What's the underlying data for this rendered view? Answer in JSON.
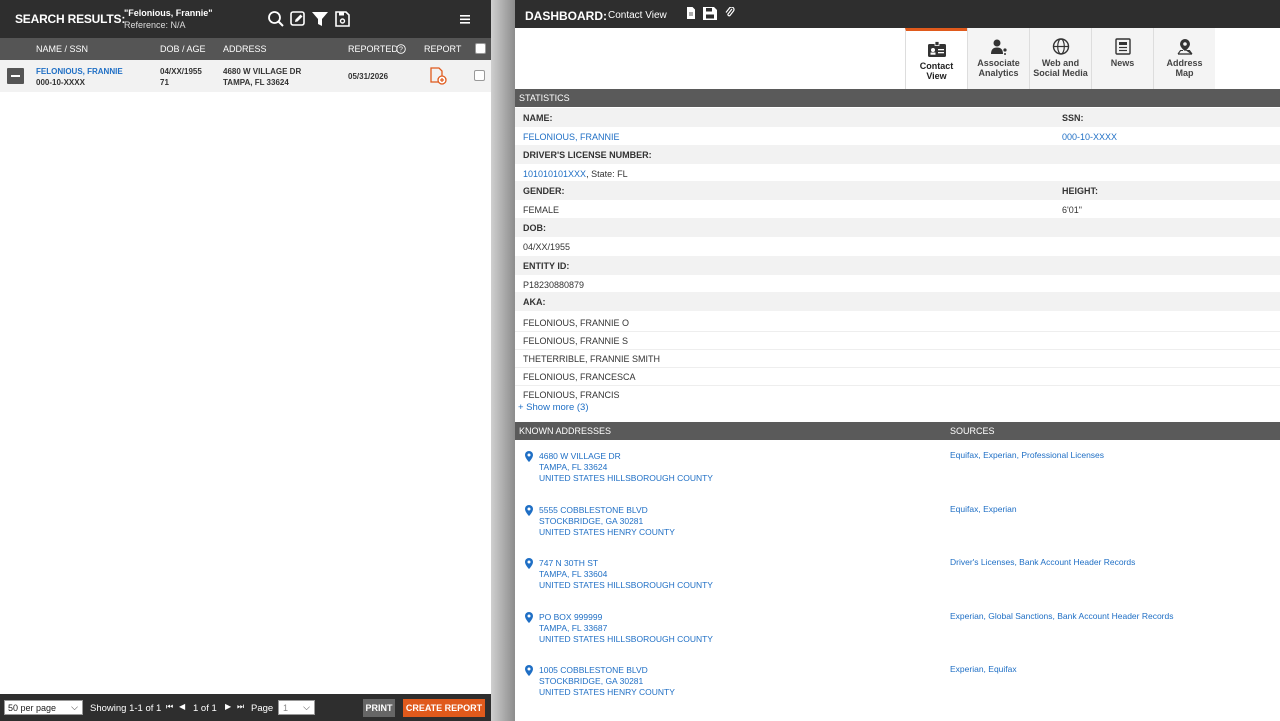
{
  "left": {
    "title": "SEARCH RESULTS:",
    "query": "\"Felonious, Frannie\"",
    "reference": "Reference: N/A",
    "icons": [
      "search-icon",
      "edit-icon",
      "filter-icon",
      "save-search-icon",
      "menu-icon"
    ],
    "columns": {
      "name_ssn": "NAME / SSN",
      "dob_age": "DOB / AGE",
      "address": "ADDRESS",
      "reported": "REPORTED",
      "report": "REPORT"
    },
    "results": [
      {
        "name": "FELONIOUS, FRANNIE",
        "ssn": "000-10-XXXX",
        "dob": "04/XX/1955",
        "age": "71",
        "address_line1": "4680 W VILLAGE DR",
        "address_line2": "TAMPA, FL 33624",
        "reported": "05/31/2026"
      }
    ],
    "footer": {
      "per_page": "50 per page",
      "showing": "Showing 1-1 of 1",
      "page_of": "1 of 1",
      "page_label": "Page",
      "page_value": "1",
      "print": "PRINT",
      "create_report": "CREATE REPORT"
    }
  },
  "right": {
    "title": "DASHBOARD:",
    "subtitle": "Contact View",
    "tabs": [
      {
        "line1": "Contact",
        "line2": "View",
        "icon": "contact-card-icon",
        "active": true
      },
      {
        "line1": "Associate",
        "line2": "Analytics",
        "icon": "associate-icon",
        "active": false
      },
      {
        "line1": "Web and",
        "line2": "Social Media",
        "icon": "globe-icon",
        "active": false
      },
      {
        "line1": "News",
        "line2": "",
        "icon": "newspaper-icon",
        "active": false
      },
      {
        "line1": "Address",
        "line2": "Map",
        "icon": "map-pin-icon",
        "active": false
      }
    ],
    "statistics": {
      "header": "STATISTICS",
      "name_label": "NAME:",
      "name": "FELONIOUS, FRANNIE",
      "ssn_label": "SSN:",
      "ssn": "000-10-XXXX",
      "dl_label": "DRIVER'S LICENSE NUMBER:",
      "dl_number": "101010101XXX",
      "dl_state": ", State: FL",
      "gender_label": "GENDER:",
      "gender": "FEMALE",
      "height_label": "HEIGHT:",
      "height": "6'01\"",
      "dob_label": "DOB:",
      "dob": "04/XX/1955",
      "entity_label": "ENTITY ID:",
      "entity_id": "P18230880879",
      "aka_label": "AKA:",
      "aka": [
        "FELONIOUS, FRANNIE O",
        "FELONIOUS, FRANNIE S",
        "THETERRIBLE, FRANNIE SMITH",
        "FELONIOUS, FRANCESCA",
        "FELONIOUS, FRANCIS"
      ],
      "show_more": "+ Show more (3)"
    },
    "addresses": {
      "header": "KNOWN ADDRESSES",
      "sources_header": "SOURCES",
      "items": [
        {
          "line1": "4680 W VILLAGE DR",
          "line2": "TAMPA, FL 33624",
          "line3": "UNITED STATES HILLSBOROUGH COUNTY",
          "sources": "Equifax, Experian, Professional Licenses"
        },
        {
          "line1": "5555 COBBLESTONE BLVD",
          "line2": "STOCKBRIDGE, GA 30281",
          "line3": "UNITED STATES HENRY COUNTY",
          "sources": "Equifax, Experian"
        },
        {
          "line1": "747 N 30TH ST",
          "line2": "TAMPA, FL 33604",
          "line3": "UNITED STATES HILLSBOROUGH COUNTY",
          "sources": "Driver's Licenses, Bank Account Header Records"
        },
        {
          "line1": "PO BOX 999999",
          "line2": "TAMPA, FL 33687",
          "line3": "UNITED STATES HILLSBOROUGH COUNTY",
          "sources": "Experian, Global Sanctions, Bank Account Header Records"
        },
        {
          "line1": "1005 COBBLESTONE BLVD",
          "line2": "STOCKBRIDGE, GA 30281",
          "line3": "UNITED STATES HENRY COUNTY",
          "sources": "Experian, Equifax"
        }
      ]
    }
  },
  "colors": {
    "accent": "#e05a1c",
    "link": "#1f6fc5",
    "header": "#2e2e2e",
    "section": "#5a5a5a"
  }
}
